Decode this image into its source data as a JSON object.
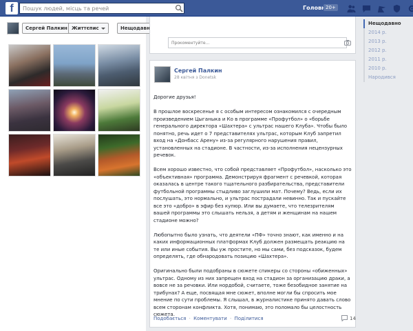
{
  "topbar": {
    "logo": "f",
    "search_placeholder": "Пошук людей, місць та речей",
    "home_label": "Головна",
    "home_count": "20+",
    "icons": [
      "friends-icon",
      "messages-icon",
      "notifications-icon",
      "privacy-icon",
      "settings-icon"
    ],
    "brand_color": "#3b5998"
  },
  "filters": {
    "name_label": "Сергей Палкин",
    "life_label": "Життєпис",
    "recent_label": "Нещодавно"
  },
  "photos": [
    "photo-1",
    "photo-2",
    "photo-3",
    "photo-4",
    "photo-5",
    "photo-6",
    "photo-7",
    "photo-8",
    "photo-9"
  ],
  "comment_top": {
    "placeholder": "Прокоментуйте..."
  },
  "post": {
    "author": "Сергей Палкин",
    "date": "28 квітня з Donetsk",
    "paragraphs": [
      "Дорогие друзья!",
      "В прошлое воскресенье я с особым интересом ознакомился с очередным произведением Цыганыка и Ко в программе «Профутбол» о «борьбе генерального директора «Шахтера» с ультрас нашего Клуба». Чтобы было понятно, речь идет о 7 представителях ультрас, которым Клуб запретил вход на «Донбасс Арену» из-за регулярного нарушения правил, установленных на стадионе. В частности, из-за исполнения нецензурных речевок.",
      "Всем хорошо известно, что собой представляет «Профутбол», насколько это «объективная» программа. Демонстрируя фрагмент с речевкой, которая оказалась в центре такого тщательного разбирательства, представители футбольной программы стыдливо заглушили мат. Почему? Ведь, если их послушать, это нормально, и ультрас пострадали невинно. Так и пускайте все это «добро» в эфир без купюр. Или вы думаете, что телезрителям вашей программы это слышать нельзя, а детям и женщинам на нашем стадионе можно?",
      "Любопытно было узнать, что деятели «ПФ» точно знают, как именно и на каких информационных платформах Клуб должен размещать реакцию на те или иные события. Вы уж простите, но мы сами, без подсказок, будем определять, где обнародовать позицию «Шахтера».",
      "Оригинально были подобраны в сюжете спикеры со стороны «обиженных» ультрас. Одному из них запрещен вход на стадион за организацию драки, а вовсе не за речовки. Или нордобой, считаете, тоже безобидное занятие на трибунах? А еще, посвящая мне сюжет, вполне могли бы спросить мое мнение по сути проблемы. Я слышал, в журналистике принято давать слово всем сторонам конфликта. Хотя, понимаю, это поломало бы целостность сюжета."
    ],
    "actions": {
      "like": "Подобається",
      "comment": "Коментувати",
      "share": "Поділитися",
      "separator": "·"
    },
    "comment_count": "14"
  },
  "timeline": {
    "items": [
      "Нещодавно",
      "2014 р.",
      "2013 р.",
      "2012 р.",
      "2011 р.",
      "2010 р.",
      "Народився"
    ],
    "active_index": 0
  }
}
